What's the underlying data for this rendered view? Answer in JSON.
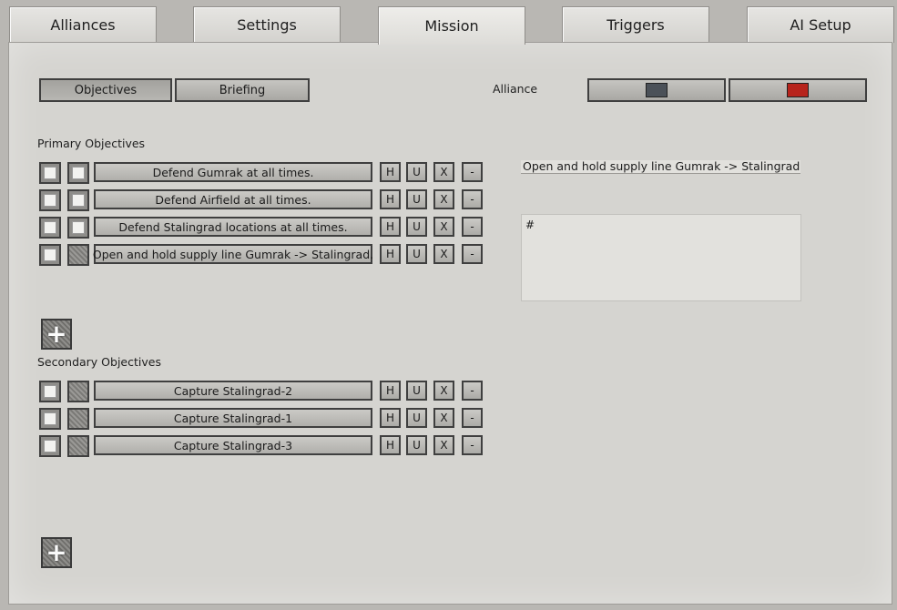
{
  "tabs": [
    {
      "label": "Alliances"
    },
    {
      "label": "Settings"
    },
    {
      "label": "Mission"
    },
    {
      "label": "Triggers"
    },
    {
      "label": "AI Setup"
    }
  ],
  "subtabs": {
    "objectives": "Objectives",
    "briefing": "Briefing"
  },
  "alliance": {
    "label": "Alliance",
    "colors": [
      "#4b5158",
      "#b7241c"
    ]
  },
  "primary": {
    "heading": "Primary Objectives",
    "items": [
      {
        "label": "Defend Gumrak at all times."
      },
      {
        "label": "Defend Airfield at all times."
      },
      {
        "label": "Defend Stalingrad locations at all times."
      },
      {
        "label": "Open and hold supply line Gumrak -> Stalingrad."
      }
    ]
  },
  "secondary": {
    "heading": "Secondary Objectives",
    "items": [
      {
        "label": "Capture Stalingrad-2"
      },
      {
        "label": "Capture Stalingrad-1"
      },
      {
        "label": "Capture Stalingrad-3"
      }
    ]
  },
  "row_buttons": {
    "h": "H",
    "u": "U",
    "x": "X",
    "minus": "-"
  },
  "add_label": "+",
  "detail": {
    "title": "Open and hold supply line Gumrak -> Stalingrad.",
    "description": "#"
  }
}
